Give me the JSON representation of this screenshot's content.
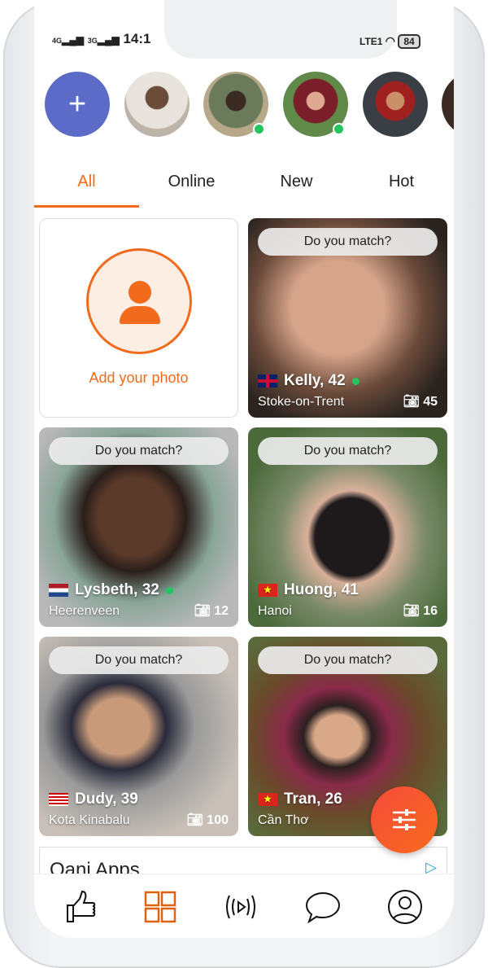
{
  "status": {
    "signal1": "4G",
    "signal2": "3G",
    "time": "14:1",
    "volte": "LTE1",
    "battery": "84"
  },
  "stories": {
    "add_icon": "plus-icon",
    "online": [
      false,
      true,
      true,
      false,
      false
    ]
  },
  "tabs": [
    {
      "label": "All",
      "active": true
    },
    {
      "label": "Online"
    },
    {
      "label": "New"
    },
    {
      "label": "Hot"
    }
  ],
  "add_photo": {
    "label": "Add your photo",
    "icon": "user-icon"
  },
  "match_label": "Do you match?",
  "profiles": [
    {
      "name": "Kelly, 42",
      "city": "Stoke-on-Trent",
      "photos": "45",
      "online": true,
      "flag": "uk"
    },
    {
      "name": "Lysbeth, 32",
      "city": "Heerenveen",
      "photos": "12",
      "online": true,
      "flag": "nl"
    },
    {
      "name": "Huong, 41",
      "city": "Hanoi",
      "photos": "16",
      "online": false,
      "flag": "vn"
    },
    {
      "name": "Dudy, 39",
      "city": "Kota Kinabalu",
      "photos": "100",
      "online": false,
      "flag": "my"
    },
    {
      "name": "Tran, 26",
      "city": "Cần Thơ",
      "photos": "",
      "online": false,
      "flag": "vn"
    }
  ],
  "ad": {
    "title": "Oani Apps"
  },
  "accent": "#f26a1b",
  "nav": [
    {
      "icon": "thumbs-up-icon"
    },
    {
      "icon": "grid-icon",
      "active": true
    },
    {
      "icon": "live-stream-icon"
    },
    {
      "icon": "chat-bubble-icon"
    },
    {
      "icon": "profile-icon"
    }
  ]
}
